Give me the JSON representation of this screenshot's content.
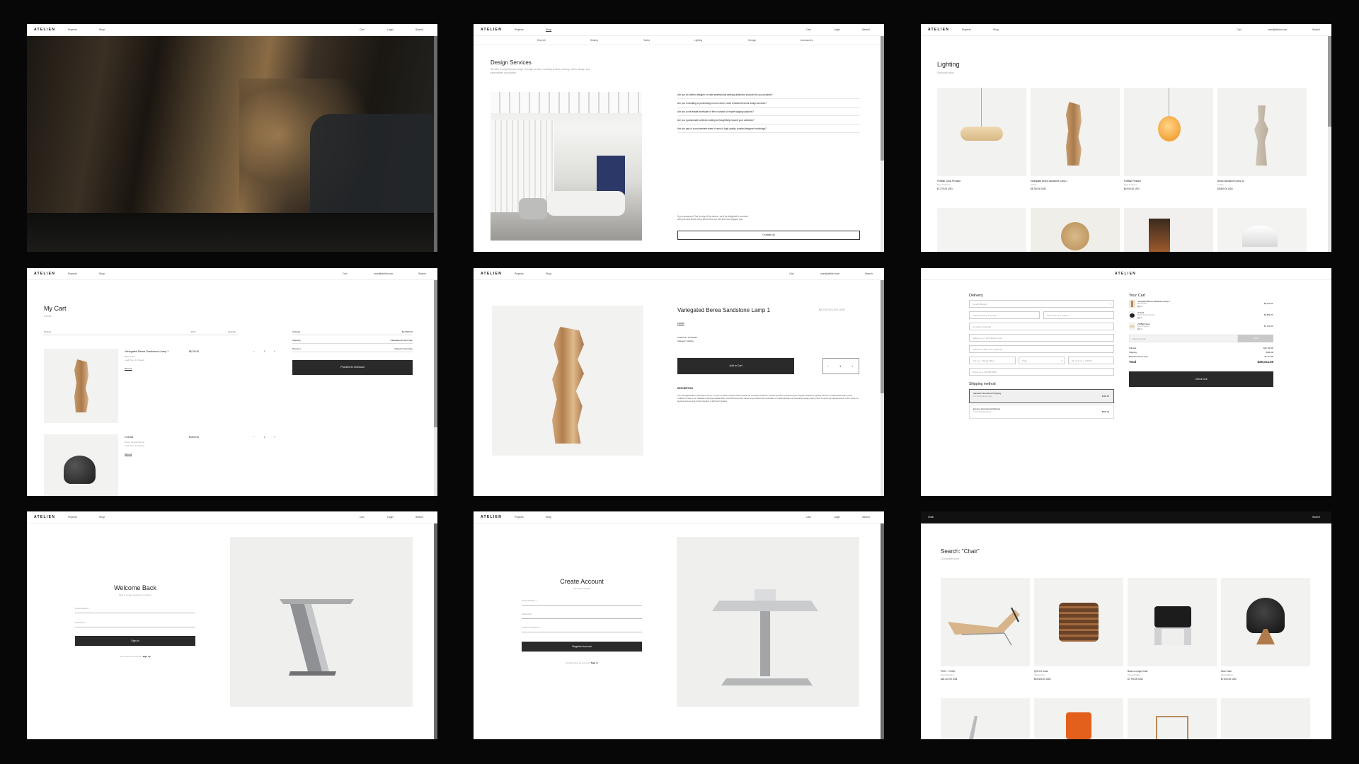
{
  "nav": {
    "logo": "ATELIEN",
    "projects": "Projects",
    "shop": "Shop",
    "login": "Login",
    "cart": "Cart",
    "search": "Search",
    "account": "user@atelier.com"
  },
  "design": {
    "subnav": [
      "Shop All",
      "Seating",
      "Tables",
      "Lighting",
      "Storage",
      "Accessories"
    ],
    "title": "Design Services",
    "intro": "We offer a comprehensive range of design services, including product sourcing, interior design, and personalised consultation.",
    "faqs": [
      "Are you an interior designer or trade professional seeking distinctive products for your projects?",
      "Are you renovating or purchasing a home and in need of tailored interior design services?",
      "Are you a real estate developer or firm in search of expert staging solutions?",
      "Are you a passionate collector looking to thoughtfully expand your collection?",
      "Are you part of a procurement team in need of high-quality, curated designer furnishings?"
    ],
    "contact_note": "If you answered 'Yes' to any of the above, we'd be delighted to connect with you and share more about how our services can support you.",
    "contact_btn": "Contact Us"
  },
  "lighting": {
    "title": "Lighting",
    "count": "8 products found",
    "products": [
      {
        "name": "PuffBall Cloud Pendant",
        "maker": "Faye Toogood",
        "price": "$7,370.00 USD"
      },
      {
        "name": "Variegated Berea Sandstone Lamp 1",
        "maker": "Lechet",
        "price": "$8,760.00 USD"
      },
      {
        "name": "PuffBall Pendant",
        "maker": "Faye Toogood",
        "price": "$4,900.00 USD"
      },
      {
        "name": "Berea Sandstone Lamp 10",
        "maker": "Lechet",
        "price": "$5,800.00 USD"
      }
    ]
  },
  "cart": {
    "title": "My Cart",
    "count": "2 items",
    "col_product": "Product",
    "col_price": "Price",
    "col_qty": "Quantity",
    "items": [
      {
        "name": "Variegated Berea Sandstone Lamp 1",
        "meta": "Black Label",
        "lead": "Lead Time: 4-6 Weeks",
        "price": "$8,760.00",
        "qty": "1",
        "remove": "Remove"
      },
      {
        "name": "O Bowl",
        "meta": "Brown Smoke Patrons",
        "lead": "Lead Time: 4-6 Weeks",
        "price": "$3,800.00",
        "qty": "1",
        "remove": "Remove"
      }
    ],
    "subtotal_label": "Subtotal",
    "subtotal": "$12,560.00",
    "shipping_label": "Shipping",
    "shipping": "Calculated at Next Step",
    "discount_label": "Discount",
    "discount": "Added in Next Step",
    "checkout_btn": "Proceed to Checkout"
  },
  "product": {
    "title": "Variegated Berea Sandstone Lamp 1",
    "price": "$8,760.00 USD USD",
    "maker": "Lechet",
    "lead": "Lead Time: 4-6 Weeks",
    "category": "Category: Lighting",
    "add_btn": "Add to Cart",
    "minus": "−",
    "qty": "1",
    "plus": "+",
    "desc_label": "DESCRIPTION",
    "desc": "The Variegated Berea Sandstone Lamp 1 is one of eleven unique editions within an exclusive collection curated by MOAI, presenting the singular sandstone lighting fixtures in collaboration with Lechet. Crafted for Sea Front Installation designed Made Beam and Milo Exercises, these lamps reflect their dedication to craftsmanship and innovative design. Each piece honours the natural beauty of the stone, its layered textures and a bold interplay of light and shadow."
  },
  "checkout": {
    "logo": "ATELIEN",
    "delivery": "Delivery",
    "fields": {
      "country": "Country/Region",
      "first": "First name (e.g. Thomas)",
      "last": "Last name (e.g. Taylor)",
      "company": "Company (optional)",
      "address": "Address (e.g. 123 Harbour Ave)",
      "apartment": "Apartment, suite, etc. (optional)",
      "city": "City (e.g. Chicago Bay)",
      "state": "State",
      "zip": "Zip code (e.g. 10003)",
      "phone": "Phone (e.g. 1234567890)"
    },
    "shipping_method": "Shipping method",
    "shipping_options": [
      {
        "name": "Standard International Shipping",
        "eta": "5 to 10 business days",
        "price": "$180.00"
      },
      {
        "name": "Express International Shipping",
        "eta": "3 to 5 business days",
        "price": "$800.00"
      }
    ],
    "your_cart": "Your Cart",
    "lines": [
      {
        "name": "Variegated Berea Sandstone Lamp 1",
        "meta": "Black Label",
        "qty": "Qty: 1",
        "price": "$8,760.00"
      },
      {
        "name": "O Bowl",
        "meta": "Brown Smoke Patrons",
        "qty": "Qty: 1",
        "price": "$3,800.00"
      },
      {
        "name": "PuffBall Cloud",
        "meta": "Faye Toogood",
        "qty": "Qty: 1",
        "price": "$7,370.00"
      }
    ],
    "discount_placeholder": "Discount code",
    "apply": "Apply",
    "subtotal_label": "Subtotal",
    "subtotal": "$25,700.00",
    "shipping_label": "Shipping",
    "shipping": "$180.00",
    "tax_label": "Estimated taxes (7%)",
    "tax": "$1,127.00",
    "total_label": "Total",
    "total": "$26,014.35",
    "checkout_btn": "Check Out"
  },
  "login": {
    "title": "Welcome Back",
    "sub": "Sign in to your account to continue",
    "email": "Email Address *",
    "password": "Password *",
    "btn": "Sign In",
    "footer": "Don't have an account?",
    "footer_link": "Sign up"
  },
  "register": {
    "title": "Create Account",
    "sub": "Join Atelier Studio",
    "email": "Email Address *",
    "password": "Password *",
    "confirm": "Confirm Password *",
    "btn": "Register Account",
    "footer": "Already have an account?",
    "footer_link": "Sign in"
  },
  "search": {
    "query_chip": "Chair",
    "search_label": "Search",
    "title": "Search: \"Chair\"",
    "count": "12 products found",
    "products": [
      {
        "name": "PK24 · Vh Bet",
        "maker": "Poul Kjærholm",
        "price": "$26,447.00 US$"
      },
      {
        "name": "QRJ-01 Chair",
        "maker": "Studio Chen",
        "price": "$19,600.00 USD"
      },
      {
        "name": "Bearn Lounge Chair",
        "maker": "Samuel Pillow",
        "price": "$7,790.00 USD"
      },
      {
        "name": "Nido Chair",
        "maker": "Studio Milano",
        "price": "$7,600.00 USD"
      }
    ]
  },
  "colors": {
    "bg": "#070707",
    "dark_button": "#2a2a2a"
  }
}
